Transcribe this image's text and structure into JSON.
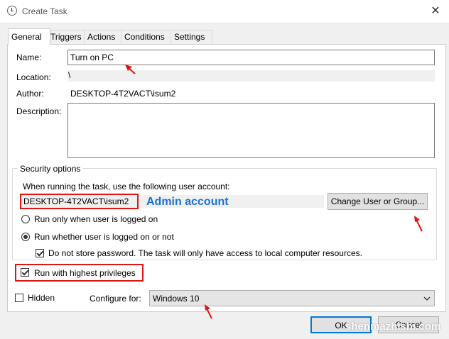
{
  "window": {
    "title": "Create Task",
    "close_glyph": "✕"
  },
  "tabs": [
    {
      "label": "General"
    },
    {
      "label": "Triggers"
    },
    {
      "label": "Actions"
    },
    {
      "label": "Conditions"
    },
    {
      "label": "Settings"
    }
  ],
  "general": {
    "name_label": "Name:",
    "name_value": "Turn on PC",
    "location_label": "Location:",
    "location_value": "\\",
    "author_label": "Author:",
    "author_value": "DESKTOP-4T2VACT\\isum2",
    "description_label": "Description:",
    "description_value": ""
  },
  "security": {
    "legend": "Security options",
    "account_prompt": "When running the task, use the following user account:",
    "account_value": "DESKTOP-4T2VACT\\isum2",
    "change_button": "Change User or Group...",
    "radio_logged_on": "Run only when user is logged on",
    "radio_whether": "Run whether user is logged on or not",
    "radio_whether_selected": true,
    "no_store_password": "Do not store password.  The task will only have access to local computer resources.",
    "no_store_password_checked": true,
    "highest_privileges": "Run with highest privileges",
    "highest_privileges_checked": true
  },
  "bottom": {
    "hidden_label": "Hidden",
    "hidden_checked": false,
    "configure_label": "Configure for:",
    "configure_value": "Windows 10",
    "ok_button": "OK",
    "cancel_button": "Cancel"
  },
  "annotations": {
    "admin_label": "Admin account",
    "annotation_color": "#e01515",
    "label_color": "#1a72d8"
  },
  "watermark": "shenmazhishi.com"
}
